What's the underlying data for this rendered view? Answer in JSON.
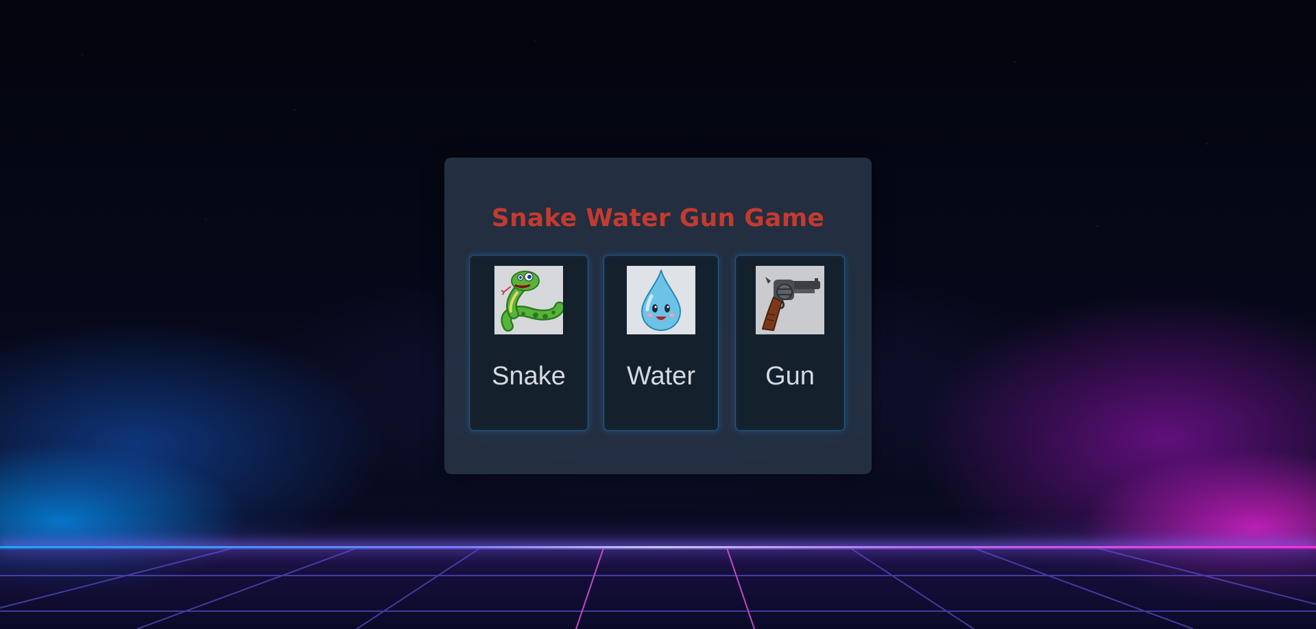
{
  "game": {
    "title": "Snake Water Gun Game",
    "choices": [
      {
        "id": "snake",
        "label": "Snake",
        "icon": "snake-icon"
      },
      {
        "id": "water",
        "label": "Water",
        "icon": "water-drop-icon"
      },
      {
        "id": "gun",
        "label": "Gun",
        "icon": "revolver-icon"
      }
    ]
  },
  "colors": {
    "title": "#c43a2f",
    "card_background": "#263244",
    "choice_background": "#15202d",
    "choice_border": "#1f5a86",
    "label": "#d5dae0",
    "horizon_left": "#18a8ff",
    "horizon_right": "#ff2ed8"
  }
}
